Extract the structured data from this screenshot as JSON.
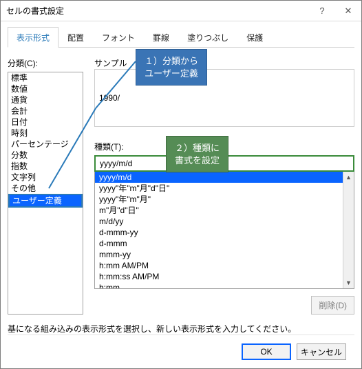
{
  "title": "セルの書式設定",
  "window_controls": {
    "help": "?",
    "close": "✕"
  },
  "tabs": [
    "表示形式",
    "配置",
    "フォント",
    "罫線",
    "塗りつぶし",
    "保護"
  ],
  "active_tab": 0,
  "category_label": "分類(C):",
  "categories": [
    "標準",
    "数値",
    "通貨",
    "会計",
    "日付",
    "時刻",
    "パーセンテージ",
    "分数",
    "指数",
    "文字列",
    "その他",
    "ユーザー定義"
  ],
  "selected_category_index": 11,
  "sample_label": "サンプル",
  "sample_value": "1990/",
  "type_label": "種類(T):",
  "type_value": "yyyy/m/d",
  "type_options": [
    "yyyy/m/d",
    "yyyy\"年\"m\"月\"d\"日\"",
    "yyyy\"年\"m\"月\"",
    "m\"月\"d\"日\"",
    "m/d/yy",
    "d-mmm-yy",
    "d-mmm",
    "mmm-yy",
    "h:mm AM/PM",
    "h:mm:ss AM/PM",
    "h:mm"
  ],
  "type_highlight_index": 0,
  "delete_button": "削除(D)",
  "help_text": "基になる組み込みの表示形式を選択し、新しい表示形式を入力してください。",
  "ok_button": "OK",
  "cancel_button": "キャンセル",
  "callout1_line1": "１）分類から",
  "callout1_line2": "ユーザー定義",
  "callout2_line1": "２）種類に",
  "callout2_line2": "書式を設定"
}
